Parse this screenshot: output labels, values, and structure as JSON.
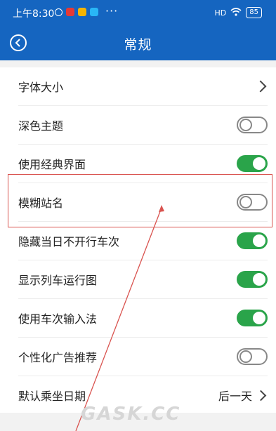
{
  "status_bar": {
    "time": "上午8:30",
    "more": "···",
    "signal": "HD",
    "battery": "85"
  },
  "header": {
    "title": "常规"
  },
  "settings": {
    "font_size": {
      "label": "字体大小"
    },
    "dark_theme": {
      "label": "深色主题",
      "enabled": false
    },
    "classic_ui": {
      "label": "使用经典界面",
      "enabled": true
    },
    "fuzzy_station": {
      "label": "模糊站名",
      "enabled": false
    },
    "hide_inactive": {
      "label": "隐藏当日不开行车次",
      "enabled": true
    },
    "show_chart": {
      "label": "显示列车运行图",
      "enabled": true
    },
    "train_input": {
      "label": "使用车次输入法",
      "enabled": true
    },
    "personal_ads": {
      "label": "个性化广告推荐",
      "enabled": false
    },
    "default_date": {
      "label": "默认乘坐日期",
      "value": "后一天"
    }
  },
  "watermark": "GASK.CC",
  "colors": {
    "brand_blue": "#1565c0",
    "toggle_on": "#2aa44a",
    "highlight": "#d9534f"
  }
}
